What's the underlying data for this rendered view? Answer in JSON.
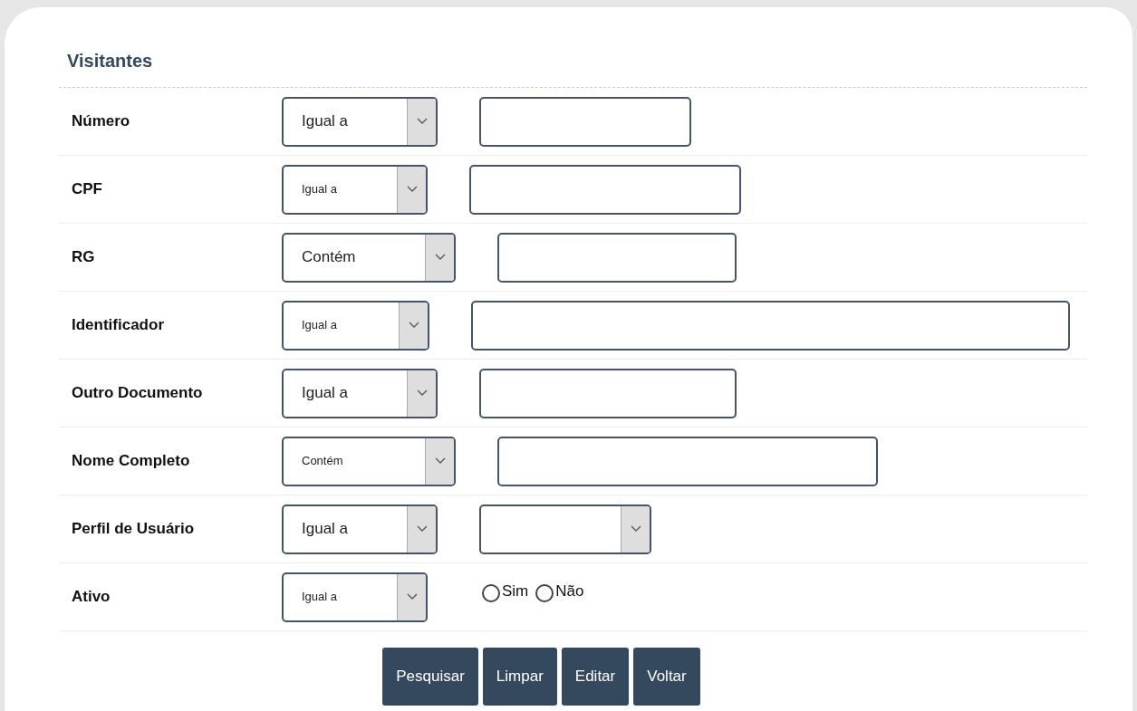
{
  "title": "Visitantes",
  "rows": [
    {
      "kind": "text",
      "label": "Número",
      "operator": "Igual a"
    },
    {
      "kind": "text",
      "label": "CPF",
      "operator": "Igual a"
    },
    {
      "kind": "text",
      "label": "RG",
      "operator": "Contém"
    },
    {
      "kind": "text",
      "label": "Identificador",
      "operator": "Igual a"
    },
    {
      "kind": "text",
      "label": "Outro Documento",
      "operator": "Igual a"
    },
    {
      "kind": "text",
      "label": "Nome Completo",
      "operator": "Contém"
    },
    {
      "kind": "select",
      "label": "Perfil de Usuário",
      "operator": "Igual a"
    },
    {
      "kind": "radio",
      "label": "Ativo",
      "operator": "Igual a",
      "options": [
        {
          "label": "Sim",
          "selected": false
        },
        {
          "label": "Não",
          "selected": false
        }
      ]
    }
  ],
  "buttons": [
    "Pesquisar",
    "Limpar",
    "Editar",
    "Voltar"
  ]
}
